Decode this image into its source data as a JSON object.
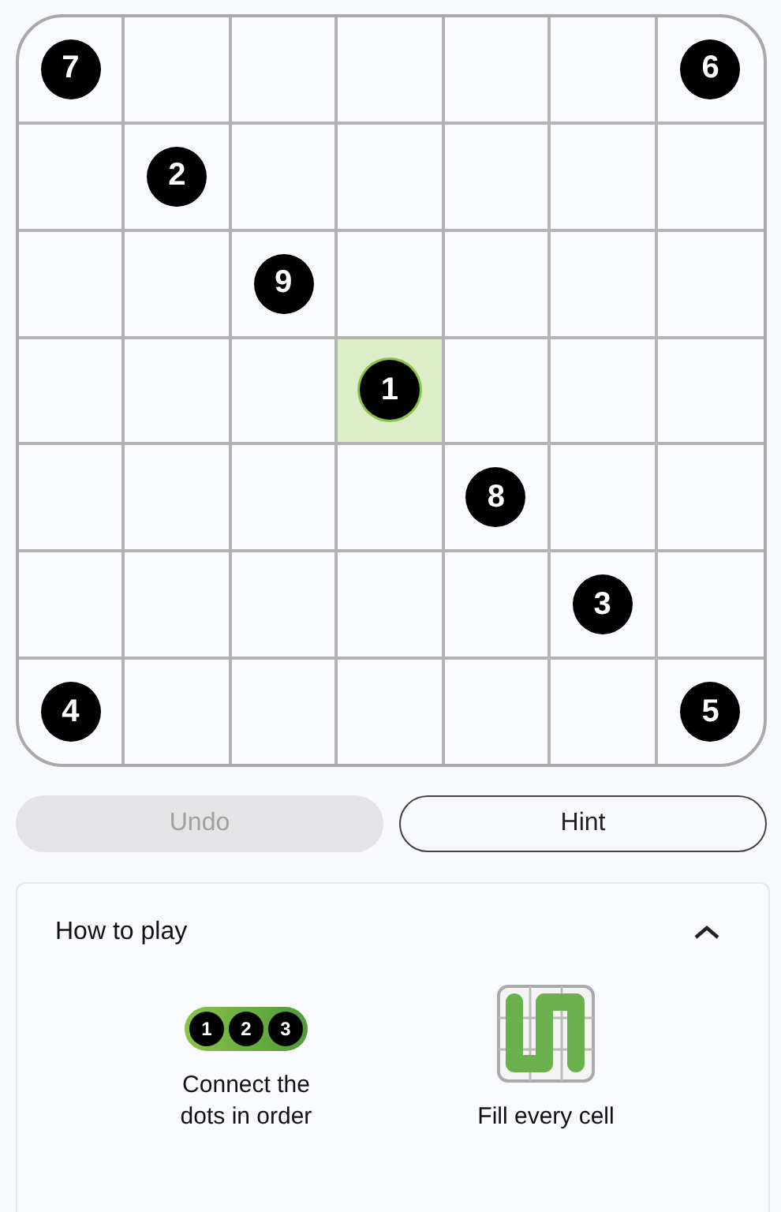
{
  "board": {
    "rows": [
      [
        {
          "number": "7",
          "filled": false
        },
        {
          "filled": false
        },
        {
          "filled": false
        },
        {
          "filled": false
        },
        {
          "filled": false
        },
        {
          "filled": false
        },
        {
          "number": "6",
          "filled": false
        }
      ],
      [
        {
          "filled": false
        },
        {
          "number": "2",
          "filled": false
        },
        {
          "filled": false
        },
        {
          "filled": false
        },
        {
          "filled": false
        },
        {
          "filled": false
        },
        {
          "filled": false
        }
      ],
      [
        {
          "filled": false
        },
        {
          "filled": false
        },
        {
          "number": "9",
          "filled": false
        },
        {
          "filled": false
        },
        {
          "filled": false
        },
        {
          "filled": false
        },
        {
          "filled": false
        }
      ],
      [
        {
          "filled": false
        },
        {
          "filled": false
        },
        {
          "filled": false
        },
        {
          "number": "1",
          "filled": true
        },
        {
          "filled": false
        },
        {
          "filled": false
        },
        {
          "filled": false
        }
      ],
      [
        {
          "filled": false
        },
        {
          "filled": false
        },
        {
          "filled": false
        },
        {
          "filled": false
        },
        {
          "number": "8",
          "filled": false
        },
        {
          "filled": false
        },
        {
          "filled": false
        }
      ],
      [
        {
          "filled": false
        },
        {
          "filled": false
        },
        {
          "filled": false
        },
        {
          "filled": false
        },
        {
          "filled": false
        },
        {
          "number": "3",
          "filled": false
        },
        {
          "filled": false
        }
      ],
      [
        {
          "number": "4",
          "filled": false
        },
        {
          "filled": false
        },
        {
          "filled": false
        },
        {
          "filled": false
        },
        {
          "filled": false
        },
        {
          "filled": false
        },
        {
          "number": "5",
          "filled": false
        }
      ]
    ]
  },
  "buttons": [
    {
      "label": "Undo",
      "disabled": true
    },
    {
      "label": "Hint",
      "disabled": false
    }
  ],
  "how_to_play": {
    "title": "How to play",
    "expanded": true,
    "tips": [
      {
        "kind": "dots",
        "dots": [
          "1",
          "2",
          "3"
        ],
        "caption": "Connect the dots in order"
      },
      {
        "kind": "fill",
        "caption": "Fill every cell"
      }
    ]
  }
}
